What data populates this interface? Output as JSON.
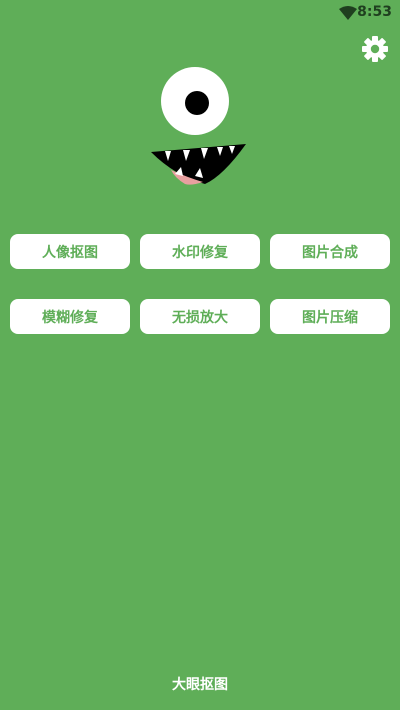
{
  "status_bar": {
    "time": "8:53",
    "wifi_icon": "wifi-icon"
  },
  "header": {
    "settings_icon": "gear-icon"
  },
  "mascot": {
    "icon": "one-eyed-monster-logo"
  },
  "tools": [
    {
      "label": "人像抠图"
    },
    {
      "label": "水印修复"
    },
    {
      "label": "图片合成"
    },
    {
      "label": "模糊修复"
    },
    {
      "label": "无损放大"
    },
    {
      "label": "图片压缩"
    }
  ],
  "footer": {
    "app_name": "大眼抠图"
  },
  "colors": {
    "background": "#5fae58",
    "button_bg": "#ffffff",
    "button_text": "#5fae58",
    "mouth_tongue": "#e8a0a0"
  }
}
